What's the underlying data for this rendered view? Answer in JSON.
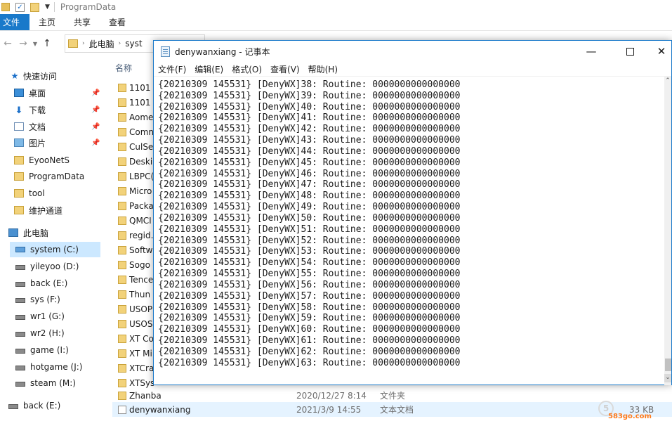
{
  "explorer": {
    "title": "ProgramData",
    "ribbon_tabs": [
      {
        "label": "文件"
      },
      {
        "label": "主页"
      },
      {
        "label": "共享"
      },
      {
        "label": "查看"
      }
    ],
    "address": {
      "segments": [
        "此电脑",
        "syst"
      ]
    },
    "nav": {
      "items": [
        {
          "label": "快速访问",
          "icon": "star-icon"
        },
        {
          "label": "桌面",
          "icon": "desktop-icon",
          "pinned": true
        },
        {
          "label": "下载",
          "icon": "download-icon",
          "pinned": true
        },
        {
          "label": "文档",
          "icon": "document-icon",
          "pinned": true
        },
        {
          "label": "图片",
          "icon": "pictures-icon",
          "pinned": true
        },
        {
          "label": "EyooNetS",
          "icon": "folder-icon"
        },
        {
          "label": "ProgramData",
          "icon": "folder-icon"
        },
        {
          "label": "tool",
          "icon": "folder-icon"
        },
        {
          "label": "维护通道",
          "icon": "folder-icon"
        },
        {
          "label": "此电脑",
          "icon": "computer-icon"
        },
        {
          "label": "system (C:)",
          "icon": "drive-icon",
          "selected": true
        },
        {
          "label": "yileyoo (D:)",
          "icon": "drive-icon"
        },
        {
          "label": "back (E:)",
          "icon": "drive-icon"
        },
        {
          "label": "sys (F:)",
          "icon": "drive-icon"
        },
        {
          "label": "wr1 (G:)",
          "icon": "drive-icon"
        },
        {
          "label": "wr2 (H:)",
          "icon": "drive-icon"
        },
        {
          "label": "game (I:)",
          "icon": "drive-icon"
        },
        {
          "label": "hotgame (J:)",
          "icon": "drive-icon"
        },
        {
          "label": "steam (M:)",
          "icon": "drive-icon"
        },
        {
          "label": "back (E:)",
          "icon": "drive-icon"
        }
      ]
    },
    "file_list": {
      "column_name": "名称",
      "rows": [
        {
          "name": "1101",
          "date": "",
          "type": "",
          "size": ""
        },
        {
          "name": "1101",
          "date": "",
          "type": "",
          "size": ""
        },
        {
          "name": "Aome",
          "date": "",
          "type": "",
          "size": ""
        },
        {
          "name": "Comn",
          "date": "",
          "type": "",
          "size": ""
        },
        {
          "name": "CulSe",
          "date": "",
          "type": "",
          "size": ""
        },
        {
          "name": "Deski",
          "date": "",
          "type": "",
          "size": ""
        },
        {
          "name": "LBPC(",
          "date": "",
          "type": "",
          "size": ""
        },
        {
          "name": "Micro",
          "date": "",
          "type": "",
          "size": ""
        },
        {
          "name": "Packa",
          "date": "",
          "type": "",
          "size": ""
        },
        {
          "name": "QMCI",
          "date": "",
          "type": "",
          "size": ""
        },
        {
          "name": "regid.",
          "date": "",
          "type": "",
          "size": ""
        },
        {
          "name": "Softw",
          "date": "",
          "type": "",
          "size": ""
        },
        {
          "name": "Sogo",
          "date": "",
          "type": "",
          "size": ""
        },
        {
          "name": "Tence",
          "date": "",
          "type": "",
          "size": ""
        },
        {
          "name": "Thun",
          "date": "",
          "type": "",
          "size": ""
        },
        {
          "name": "USOP",
          "date": "",
          "type": "",
          "size": ""
        },
        {
          "name": "USOS",
          "date": "",
          "type": "",
          "size": ""
        },
        {
          "name": "XT Co",
          "date": "",
          "type": "",
          "size": ""
        },
        {
          "name": "XT Mi",
          "date": "",
          "type": "",
          "size": ""
        },
        {
          "name": "XTCra",
          "date": "",
          "type": "",
          "size": ""
        },
        {
          "name": "XTSys",
          "date": "",
          "type": "",
          "size": ""
        },
        {
          "name": "Zhanba",
          "date": "2020/12/27 8:14",
          "type": "文件夹",
          "size": ""
        },
        {
          "name": "denywanxiang",
          "date": "2021/3/9 14:55",
          "type": "文本文档",
          "size": "33 KB",
          "selected": true
        }
      ]
    },
    "watermark": {
      "circle": "5",
      "text": "583go.com"
    }
  },
  "notepad": {
    "title": "denywanxiang - 记事本",
    "controls": {
      "minimize": "—",
      "close": "✕"
    },
    "menu": [
      "文件(F)",
      "编辑(E)",
      "格式(O)",
      "查看(V)",
      "帮助(H)"
    ],
    "lines": [
      "{20210309 145531} [DenyWX]38: Routine: 0000000000000000",
      "{20210309 145531} [DenyWX]39: Routine: 0000000000000000",
      "{20210309 145531} [DenyWX]40: Routine: 0000000000000000",
      "{20210309 145531} [DenyWX]41: Routine: 0000000000000000",
      "{20210309 145531} [DenyWX]42: Routine: 0000000000000000",
      "{20210309 145531} [DenyWX]43: Routine: 0000000000000000",
      "{20210309 145531} [DenyWX]44: Routine: 0000000000000000",
      "{20210309 145531} [DenyWX]45: Routine: 0000000000000000",
      "{20210309 145531} [DenyWX]46: Routine: 0000000000000000",
      "{20210309 145531} [DenyWX]47: Routine: 0000000000000000",
      "{20210309 145531} [DenyWX]48: Routine: 0000000000000000",
      "{20210309 145531} [DenyWX]49: Routine: 0000000000000000",
      "{20210309 145531} [DenyWX]50: Routine: 0000000000000000",
      "{20210309 145531} [DenyWX]51: Routine: 0000000000000000",
      "{20210309 145531} [DenyWX]52: Routine: 0000000000000000",
      "{20210309 145531} [DenyWX]53: Routine: 0000000000000000",
      "{20210309 145531} [DenyWX]54: Routine: 0000000000000000",
      "{20210309 145531} [DenyWX]55: Routine: 0000000000000000",
      "{20210309 145531} [DenyWX]56: Routine: 0000000000000000",
      "{20210309 145531} [DenyWX]57: Routine: 0000000000000000",
      "{20210309 145531} [DenyWX]58: Routine: 0000000000000000",
      "{20210309 145531} [DenyWX]59: Routine: 0000000000000000",
      "{20210309 145531} [DenyWX]60: Routine: 0000000000000000",
      "{20210309 145531} [DenyWX]61: Routine: 0000000000000000",
      "{20210309 145531} [DenyWX]62: Routine: 0000000000000000",
      "{20210309 145531} [DenyWX]63: Routine: 0000000000000000"
    ]
  },
  "colors": {
    "accent": "#1979ca",
    "selection": "#cce8ff",
    "folder": "#f2d27a"
  }
}
